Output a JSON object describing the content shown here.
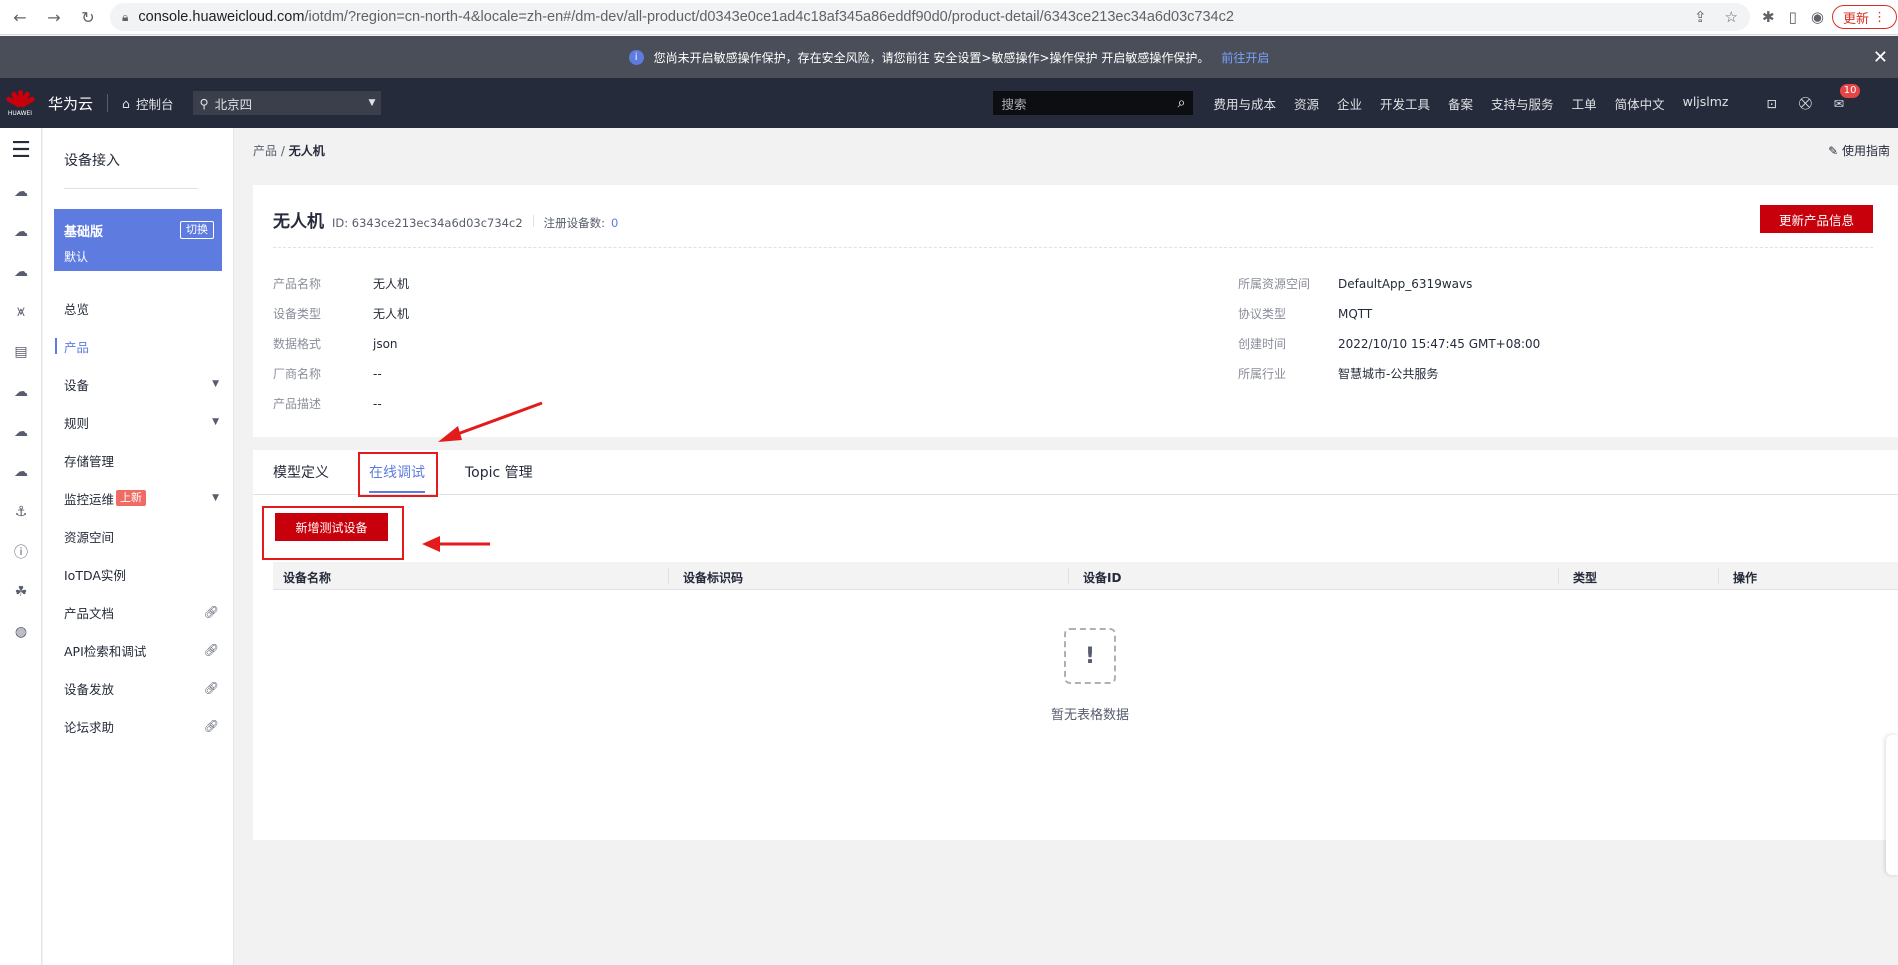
{
  "browser": {
    "url_domain": "console.huaweicloud.com",
    "url_path": "/iotdm/?region=cn-north-4&locale=zh-en#/dm-dev/all-product/d0343e0ce1ad4c18af345a86eddf90d0/product-detail/6343ce213ec34a6d03c734c2",
    "update_label": "更新"
  },
  "notice": {
    "text": "您尚未开启敏感操作保护，存在安全风险，请您前往 安全设置>敏感操作>操作保护 开启敏感操作保护。",
    "link": "前往开启"
  },
  "header": {
    "logo_word": "HUAWEI",
    "brand": "华为云",
    "console": "控制台",
    "region": "北京四",
    "search_placeholder": "搜索",
    "menu": [
      "费用与成本",
      "资源",
      "企业",
      "开发工具",
      "备案",
      "支持与服务",
      "工单",
      "简体中文",
      "wljslmz"
    ],
    "badge_count": "10"
  },
  "sidebar": {
    "title": "设备接入",
    "edition_name": "基础版",
    "edition_sub": "默认",
    "edition_switch": "切换",
    "items": [
      {
        "label": "总览"
      },
      {
        "label": "产品"
      },
      {
        "label": "设备"
      },
      {
        "label": "规则"
      },
      {
        "label": "存储管理"
      },
      {
        "label": "监控运维"
      },
      {
        "label": "资源空间"
      },
      {
        "label": "IoTDA实例"
      },
      {
        "label": "产品文档"
      },
      {
        "label": "API检索和调试"
      },
      {
        "label": "设备发放"
      },
      {
        "label": "论坛求助"
      }
    ],
    "new_tag": "上新"
  },
  "breadcrumb": {
    "parent": "产品",
    "sep": "/",
    "current": "无人机"
  },
  "guide_label": "使用指南",
  "product": {
    "name": "无人机",
    "id_text": "ID: 6343ce213ec34a6d03c734c2",
    "reg_label": "注册设备数:",
    "reg_count": "0",
    "update_btn": "更新产品信息",
    "left": [
      {
        "k": "产品名称",
        "v": "无人机"
      },
      {
        "k": "设备类型",
        "v": "无人机"
      },
      {
        "k": "数据格式",
        "v": "json"
      },
      {
        "k": "厂商名称",
        "v": "--"
      },
      {
        "k": "产品描述",
        "v": "--"
      }
    ],
    "right": [
      {
        "k": "所属资源空间",
        "v": "DefaultApp_6319wavs"
      },
      {
        "k": "协议类型",
        "v": "MQTT"
      },
      {
        "k": "创建时间",
        "v": "2022/10/10 15:47:45 GMT+08:00"
      },
      {
        "k": "所属行业",
        "v": "智慧城市-公共服务"
      }
    ]
  },
  "tabs": [
    "模型定义",
    "在线调试",
    "Topic 管理"
  ],
  "add_device_btn": "新增测试设备",
  "table": {
    "columns": [
      "设备名称",
      "设备标识码",
      "设备ID",
      "类型",
      "操作"
    ],
    "empty_text": "暂无表格数据"
  }
}
